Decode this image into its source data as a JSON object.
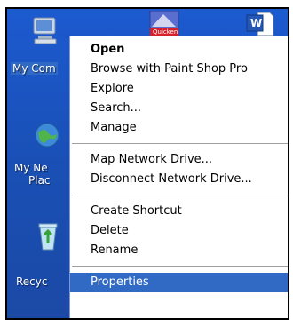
{
  "desktop": {
    "icons": [
      {
        "name": "my-computer",
        "label": "My Com"
      },
      {
        "name": "my-network-places",
        "label_line1": "My Ne",
        "label_line2": "Plac"
      },
      {
        "name": "recycle-bin",
        "label": "Recyc"
      },
      {
        "name": "quicken",
        "badge": "Quicken"
      },
      {
        "name": "word-doc",
        "badge": "W"
      }
    ]
  },
  "context_menu": {
    "items": [
      {
        "label": "Open",
        "bold": true
      },
      {
        "label": "Browse with Paint Shop Pro"
      },
      {
        "label": "Explore"
      },
      {
        "label": "Search..."
      },
      {
        "label": "Manage"
      },
      {
        "label": "Map Network Drive..."
      },
      {
        "label": "Disconnect Network Drive..."
      },
      {
        "label": "Create Shortcut"
      },
      {
        "label": "Delete"
      },
      {
        "label": "Rename"
      },
      {
        "label": "Properties",
        "highlighted": true
      }
    ]
  },
  "colors": {
    "desktop": "#1a4fb8",
    "highlight": "#316ac5",
    "menu_bg": "#ffffff"
  }
}
